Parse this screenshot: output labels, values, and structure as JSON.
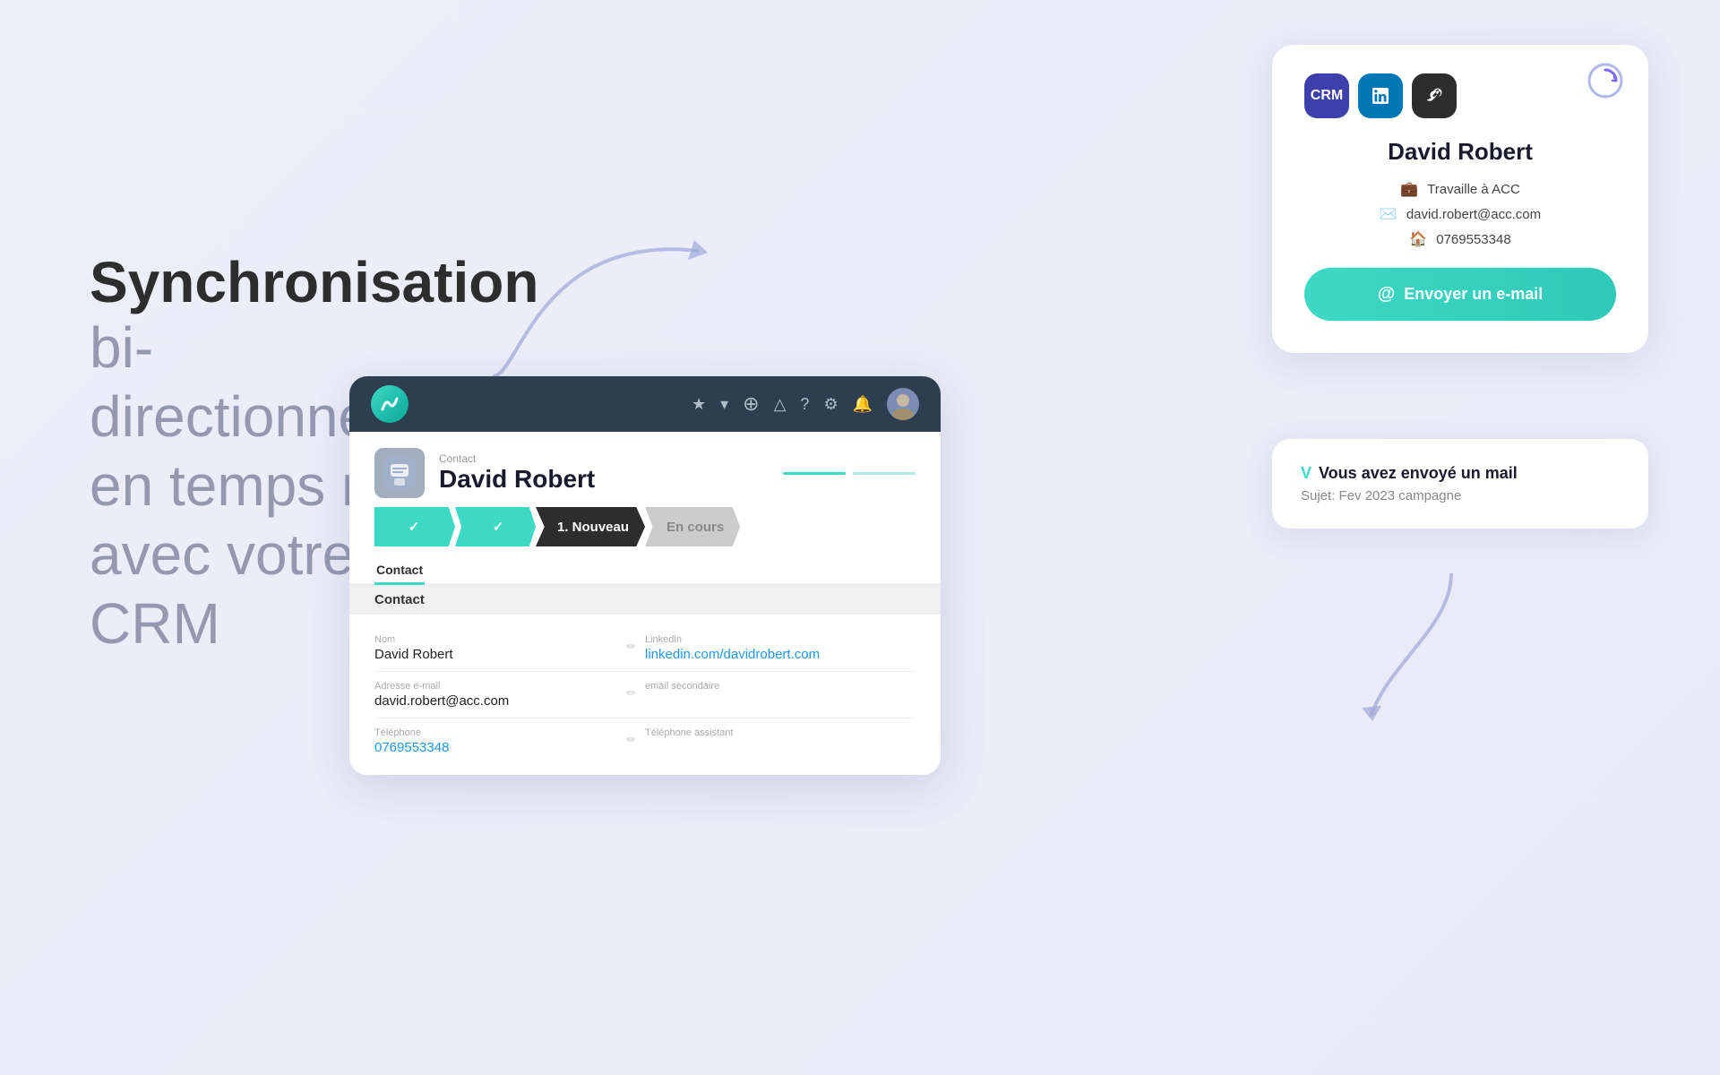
{
  "page": {
    "bg_color": "#eceef8"
  },
  "hero": {
    "title_bold": "Synchronisation",
    "title_light_1": "bi-directionnelle,",
    "title_light_2": "en temps réel",
    "title_light_3": "avec votre CRM"
  },
  "contact_card": {
    "name": "David Robert",
    "company": "Travaille à ACC",
    "email": "david.robert@acc.com",
    "phone": "0769553348",
    "email_btn_label": "Envoyer un e-mail",
    "app_icons": [
      "CRM",
      "in",
      "🔗"
    ]
  },
  "mail_notification": {
    "title": "Vous avez envoyé un mail",
    "subject_label": "Sujet:",
    "subject": "Fev 2023 campagne"
  },
  "crm_window": {
    "contact_label": "Contact",
    "contact_name": "David Robert",
    "steps": [
      "✓",
      "✓",
      "1. Nouveau",
      "En cours"
    ],
    "tab": "Contact",
    "section_title": "Contact",
    "fields": [
      {
        "label": "Nom",
        "value": "David Robert",
        "type": "text"
      },
      {
        "label": "Linkedin",
        "value": "linkedin.com/davidrobert.com",
        "type": "link"
      },
      {
        "label": "Adresse e-mail",
        "value": "david.robert@acc.com",
        "type": "text"
      },
      {
        "label": "email secondaire",
        "value": "",
        "type": "text"
      },
      {
        "label": "Téléphone",
        "value": "0769553348",
        "type": "phone"
      },
      {
        "label": "Téléphone assistant",
        "value": "",
        "type": "text"
      }
    ]
  }
}
